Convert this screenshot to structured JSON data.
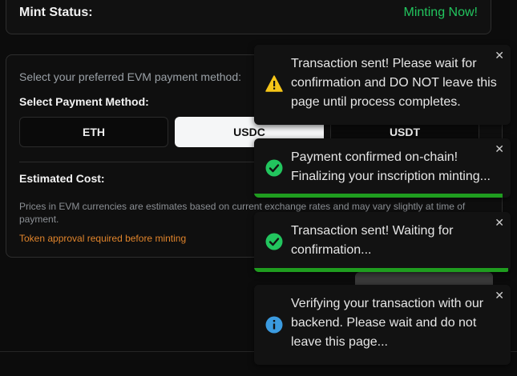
{
  "mint": {
    "label": "Mint Status:",
    "value": "Minting Now!",
    "value_color": "#22c55e"
  },
  "payment": {
    "intro": "Select your preferred EVM payment method:",
    "method_label": "Select Payment Method:",
    "methods": [
      {
        "label": "ETH",
        "selected": false
      },
      {
        "label": "USDC",
        "selected": true
      },
      {
        "label": "USDT",
        "selected": false
      }
    ],
    "estimated_cost_label": "Estimated Cost:",
    "disclaimer": "Prices in EVM currencies are estimates based on current exchange rates and may vary slightly at time of payment.",
    "approval_note": "Token approval required before minting"
  },
  "toasts": [
    {
      "type": "warning",
      "icon": "warning-icon",
      "text": "Transaction sent! Please wait for confirmation and DO NOT leave this page until process completes.",
      "close": "✕",
      "progress": null
    },
    {
      "type": "success",
      "icon": "check-circle-icon",
      "text": "Payment confirmed on-chain! Finalizing your inscription minting...",
      "close": "✕",
      "progress": 0.97
    },
    {
      "type": "success",
      "icon": "check-circle-icon",
      "text": "Transaction sent! Waiting for confirmation...",
      "close": "✕",
      "progress": 0.99
    },
    {
      "type": "info",
      "icon": "info-icon",
      "text": "Verifying your transaction with our backend. Please wait and do not leave this page...",
      "close": "✕",
      "progress": null
    }
  ],
  "colors": {
    "warning": "#f5c518",
    "success": "#22c55e",
    "info": "#3b9be0",
    "progress": "#1f9d1f"
  }
}
